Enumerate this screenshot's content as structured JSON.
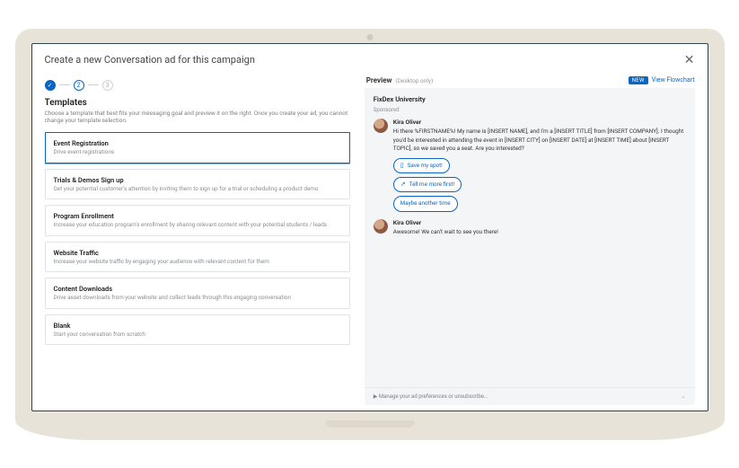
{
  "dialog": {
    "title": "Create a new Conversation ad for this campaign"
  },
  "steps": {
    "current_num": "2",
    "next_num": "3"
  },
  "section": {
    "title": "Templates",
    "desc": "Choose a template that best fits your messaging goal and preview it on the right. Once you create your ad, you cannot change your template selection."
  },
  "templates": [
    {
      "title": "Event Registration",
      "desc": "Drive event registrations"
    },
    {
      "title": "Trials & Demos Sign up",
      "desc": "Get your potential customer's attention by inviting them to sign up for a trial or scheduling a product demo"
    },
    {
      "title": "Program Enrollment",
      "desc": "Increase your education program's enrollment by sharing relevant content with your potential students / leads"
    },
    {
      "title": "Website Traffic",
      "desc": "Increase your website traffic by engaging your audience with relevant content for them"
    },
    {
      "title": "Content Downloads",
      "desc": "Drive asset downloads from your website and collect leads through this engaging conversation"
    },
    {
      "title": "Blank",
      "desc": "Start your conversation from scratch"
    }
  ],
  "preview": {
    "label": "Preview",
    "hint": "(Desktop only)",
    "new_badge": "NEW",
    "view_flowchart": "View Flowchart",
    "brand": "FixDex University",
    "sponsored": "Sponsored",
    "sender": "Kira Oliver",
    "msg1": "Hi there %FIRSTNAME%! My name is [INSERT NAME], and I'm a [INSERT TITLE] from [INSERT COMPANY]. I thought you'd be interested in attending the event in [INSERT CITY] on [INSERT DATE] at [INSERT TIME] about [INSERT TOPIC], so we saved you a seat. Are you interested?",
    "cta1": "Save my spot!",
    "cta2": "Tell me more first!",
    "cta3": "Maybe another time",
    "msg2": "Awesome! We can't wait to see you there!",
    "footer": "Manage your ad preferences or unsubscribe…"
  }
}
